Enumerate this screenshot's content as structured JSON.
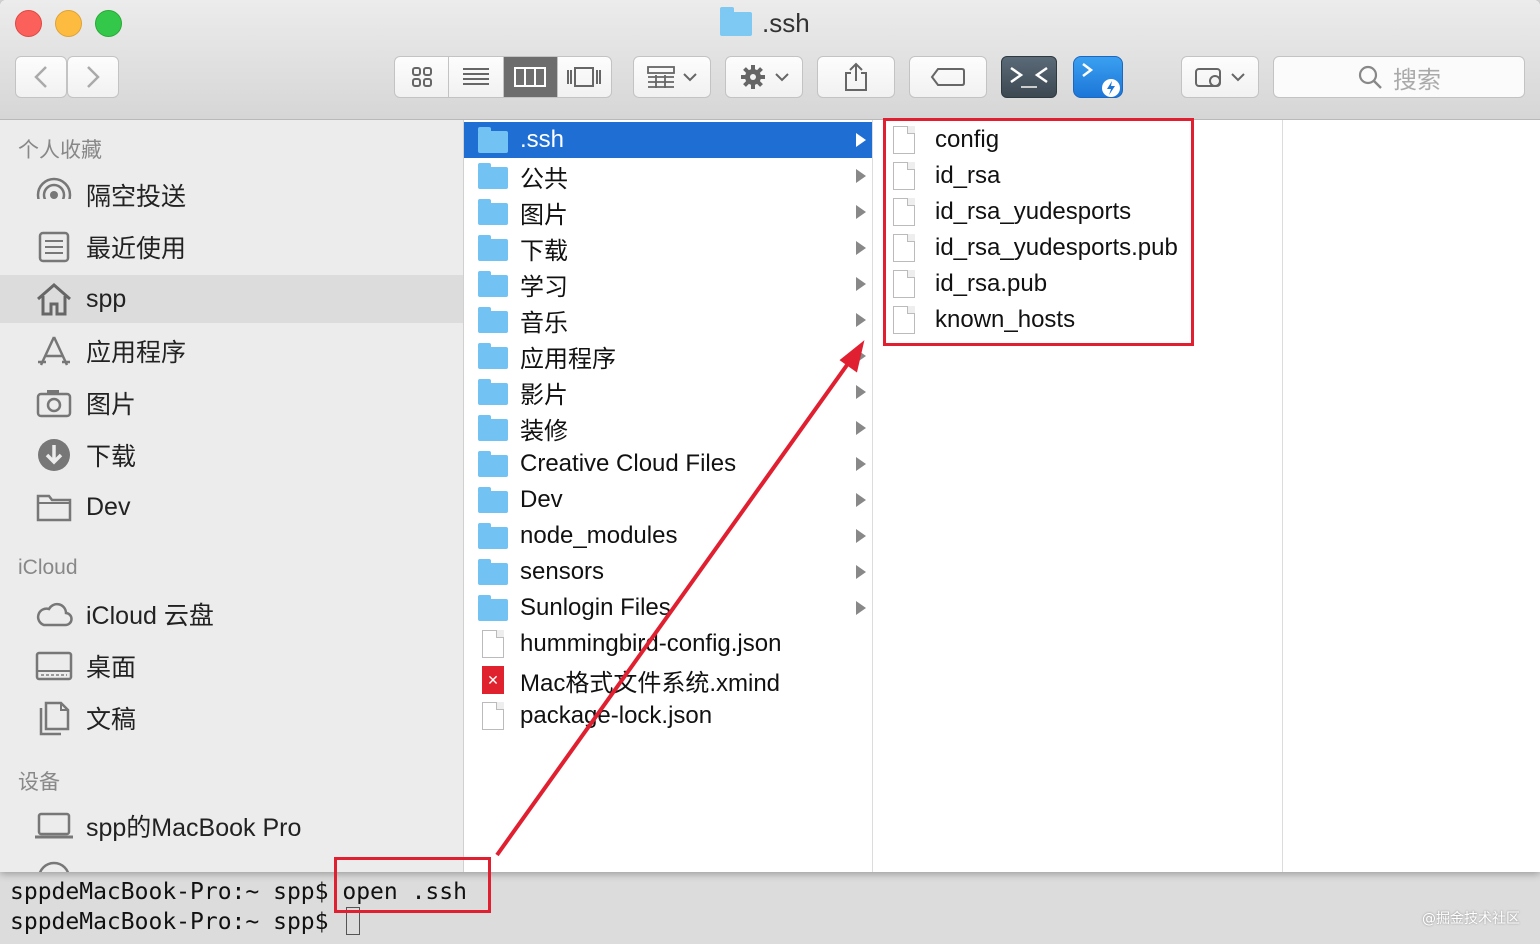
{
  "window": {
    "title": ".ssh"
  },
  "search": {
    "placeholder": "搜索"
  },
  "sidebar": {
    "sections": [
      {
        "heading": "个人收藏"
      },
      {
        "heading": "iCloud"
      },
      {
        "heading": "设备"
      }
    ],
    "favorites": [
      {
        "label": "隔空投送",
        "icon": "airdrop-icon"
      },
      {
        "label": "最近使用",
        "icon": "recents-icon"
      },
      {
        "label": "spp",
        "icon": "home-icon",
        "selected": true
      },
      {
        "label": "应用程序",
        "icon": "applications-icon"
      },
      {
        "label": "图片",
        "icon": "camera-icon"
      },
      {
        "label": "下载",
        "icon": "download-icon"
      },
      {
        "label": "Dev",
        "icon": "folder-icon"
      }
    ],
    "icloud": [
      {
        "label": "iCloud 云盘",
        "icon": "cloud-icon"
      },
      {
        "label": "桌面",
        "icon": "desktop-icon"
      },
      {
        "label": "文稿",
        "icon": "documents-icon"
      }
    ],
    "devices": [
      {
        "label": "spp的MacBook Pro",
        "icon": "laptop-icon"
      }
    ]
  },
  "column1": {
    "items": [
      {
        "label": ".ssh",
        "type": "folder",
        "selected": true
      },
      {
        "label": "公共",
        "type": "folder"
      },
      {
        "label": "图片",
        "type": "folder"
      },
      {
        "label": "下载",
        "type": "folder"
      },
      {
        "label": "学习",
        "type": "folder"
      },
      {
        "label": "音乐",
        "type": "folder"
      },
      {
        "label": "应用程序",
        "type": "folder"
      },
      {
        "label": "影片",
        "type": "folder"
      },
      {
        "label": "装修",
        "type": "folder"
      },
      {
        "label": "Creative Cloud Files",
        "type": "folder"
      },
      {
        "label": "Dev",
        "type": "folder"
      },
      {
        "label": "node_modules",
        "type": "folder"
      },
      {
        "label": "sensors",
        "type": "folder"
      },
      {
        "label": "Sunlogin Files",
        "type": "folder"
      },
      {
        "label": "hummingbird-config.json",
        "type": "file"
      },
      {
        "label": "Mac格式文件系统.xmind",
        "type": "xmind"
      },
      {
        "label": "package-lock.json",
        "type": "file"
      }
    ]
  },
  "column2": {
    "items": [
      {
        "label": "config"
      },
      {
        "label": "id_rsa"
      },
      {
        "label": "id_rsa_yudesports"
      },
      {
        "label": "id_rsa_yudesports.pub"
      },
      {
        "label": "id_rsa.pub"
      },
      {
        "label": "known_hosts"
      }
    ]
  },
  "terminal": {
    "line1_prompt": "sppdeMacBook-Pro:~ spp$ ",
    "line1_cmd": "open .ssh",
    "line2_prompt": "sppdeMacBook-Pro:~ spp$ "
  },
  "watermark": "@掘金技术社区",
  "colors": {
    "selection": "#1f6ed4",
    "annotation": "#e02030",
    "folder": "#72c2f3"
  }
}
